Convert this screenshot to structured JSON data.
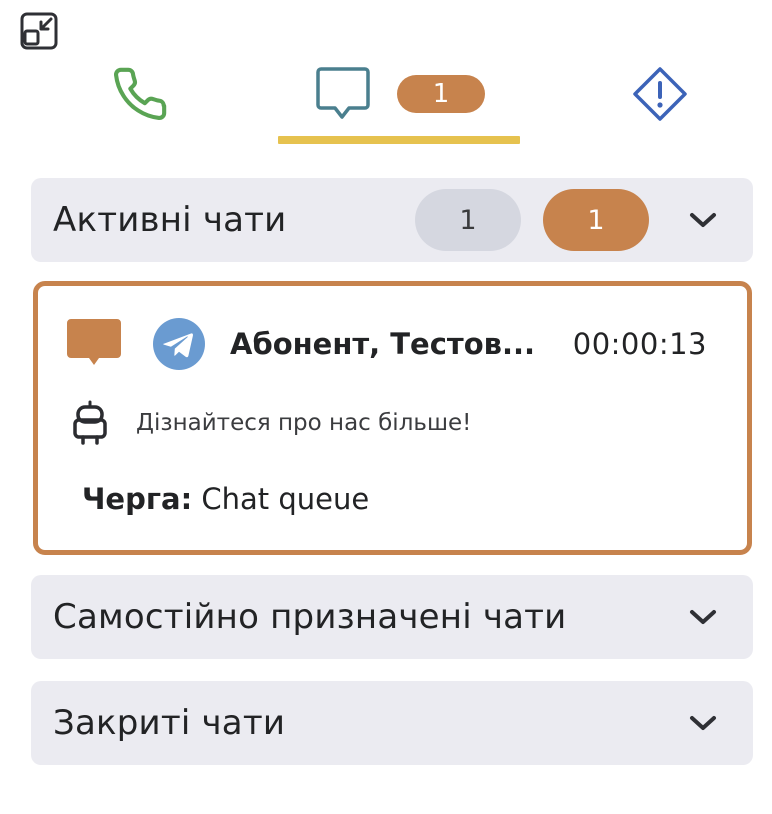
{
  "header": {
    "minimize_icon": "minimize-window-icon"
  },
  "tabs": [
    {
      "id": "calls",
      "icon": "phone-icon",
      "color": "#5aa454"
    },
    {
      "id": "chats",
      "icon": "chat-bubble-icon",
      "color": "#4a7f8e",
      "badge": "1",
      "active": true
    },
    {
      "id": "alerts",
      "icon": "alert-diamond-icon",
      "color": "#3c63b8"
    }
  ],
  "colors": {
    "accent_orange": "#c7834d",
    "tab_underline": "#e6c24f",
    "section_bg": "#ebebf1",
    "pill_gray": "#d5d7e0"
  },
  "sections": {
    "active": {
      "title": "Активні чати",
      "count_gray": "1",
      "count_orange": "1",
      "chats": [
        {
          "name": "Абонент, Тестов...",
          "timer": "00:00:13",
          "channel_icon": "telegram-icon",
          "status_icon": "chat-bubble-icon",
          "sender_icon": "bot-icon",
          "last_message": "Дізнайтеся про нас більше!",
          "queue_label": "Черга:",
          "queue_value": "Chat queue"
        }
      ]
    },
    "self_assigned": {
      "title": "Самостійно призначені чати"
    },
    "closed": {
      "title": "Закриті чати"
    }
  }
}
